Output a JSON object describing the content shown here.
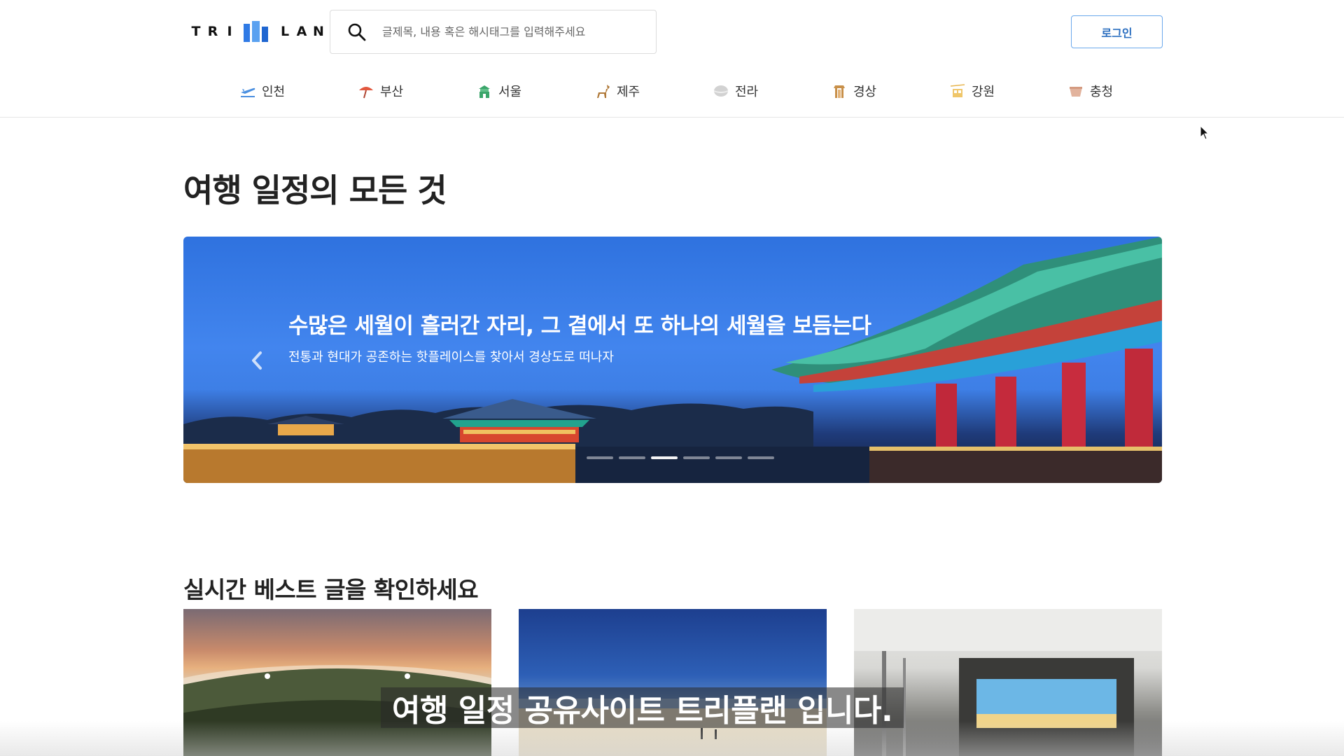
{
  "header": {
    "logo_letters_left": [
      "T",
      "R",
      "I"
    ],
    "logo_letters_right": [
      "L",
      "A",
      "N"
    ],
    "search_placeholder": "글제목, 내용 혹은 해시태그를 입력해주세요",
    "login_label": "로그인"
  },
  "nav": {
    "items": [
      {
        "label": "인천",
        "icon": "airplane-icon",
        "color": "#4a8fe0"
      },
      {
        "label": "부산",
        "icon": "parasol-icon",
        "color": "#e2583f"
      },
      {
        "label": "서울",
        "icon": "palace-gate-icon",
        "color": "#3aa56a"
      },
      {
        "label": "제주",
        "icon": "horse-icon",
        "color": "#b07a3a"
      },
      {
        "label": "전라",
        "icon": "bibimbap-icon",
        "color": "#b9b9b9"
      },
      {
        "label": "경상",
        "icon": "pagoda-icon",
        "color": "#c8904a"
      },
      {
        "label": "강원",
        "icon": "cable-car-icon",
        "color": "#e7b54f"
      },
      {
        "label": "충청",
        "icon": "bowl-icon",
        "color": "#d9a58a"
      }
    ]
  },
  "main": {
    "title": "여행 일정의 모든 것",
    "banner": {
      "title": "수많은 세월이 흘러간 자리, 그 곁에서 또 하나의 세월을 보듬는다",
      "subtitle": "전통과 현대가 공존하는 핫플레이스를 찾아서 경상도로 떠나자",
      "slides": 6,
      "active_slide": 3
    },
    "best_title": "실시간 베스트 글을 확인하세요",
    "cards": [
      "baseball-stadium-photo",
      "anmok-beach-photo",
      "building-lobby-photo"
    ]
  },
  "video": {
    "caption": "여행 일정 공유사이트 트리플랜 입니다."
  }
}
